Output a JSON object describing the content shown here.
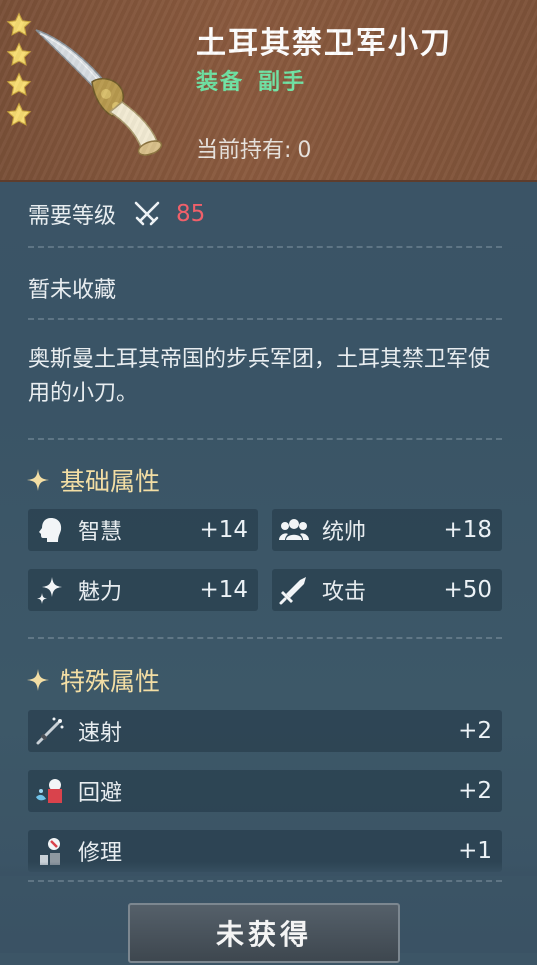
{
  "item": {
    "name": "土耳其禁卫军小刀",
    "type": "装备",
    "slot": "副手",
    "owned_label": "当前持有:",
    "owned_value": "0",
    "stars": 4
  },
  "requirement": {
    "label": "需要等级",
    "level": "85",
    "icon": "crossed-swords-icon"
  },
  "collection_status": "暂未收藏",
  "description": "奥斯曼土耳其帝国的步兵军团，土耳其禁卫军使用的小刀。",
  "basic_attributes": {
    "title": "基础属性",
    "items": [
      {
        "name": "智慧",
        "value": "+14",
        "icon": "head-icon"
      },
      {
        "name": "统帅",
        "value": "+18",
        "icon": "group-icon"
      },
      {
        "name": "魅力",
        "value": "+14",
        "icon": "sparkle-icon"
      },
      {
        "name": "攻击",
        "value": "+50",
        "icon": "sword-icon"
      }
    ]
  },
  "special_attributes": {
    "title": "特殊属性",
    "items": [
      {
        "name": "速射",
        "value": "+2",
        "icon": "rapid-fire-icon"
      },
      {
        "name": "回避",
        "value": "+2",
        "icon": "dodge-icon"
      },
      {
        "name": "修理",
        "value": "+1",
        "icon": "repair-icon"
      }
    ]
  },
  "action_button": "未获得",
  "colors": {
    "header": "#85583d",
    "type_green": "#6fe3a4",
    "level_red": "#f0606a",
    "section_gold": "#f3dea4"
  }
}
